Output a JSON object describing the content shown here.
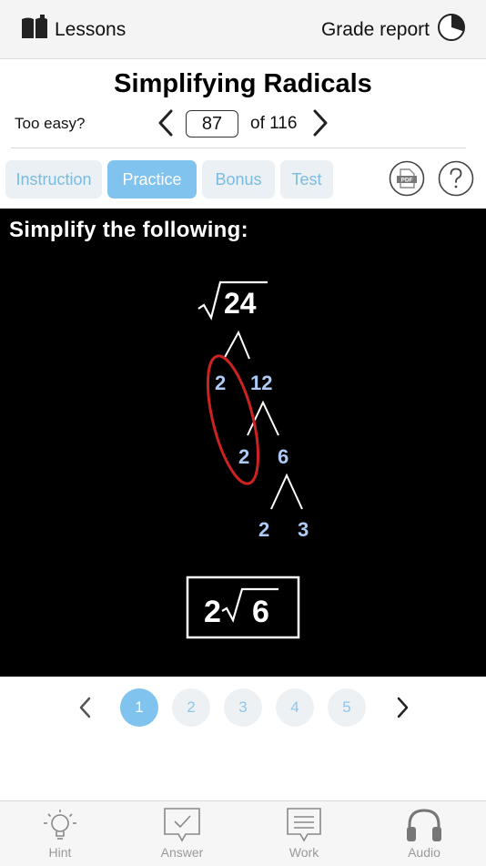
{
  "header": {
    "lessons_label": "Lessons",
    "grade_report_label": "Grade report"
  },
  "lesson": {
    "title": "Simplifying Radicals",
    "too_easy": "Too easy?",
    "current_page": "87",
    "of_total": "of 116"
  },
  "tabs": [
    {
      "label": "Instruction"
    },
    {
      "label": "Practice"
    },
    {
      "label": "Bonus"
    },
    {
      "label": "Test"
    }
  ],
  "problem": {
    "heading": "Simplify the following:",
    "radicand": "24",
    "tree": {
      "level1_left": "2",
      "level1_right": "12",
      "level2_left": "2",
      "level2_right": "6",
      "level3_left": "2",
      "level3_right": "3"
    },
    "answer_coefficient": "2",
    "answer_radicand": "6"
  },
  "pager": {
    "pages": [
      "1",
      "2",
      "3",
      "4",
      "5"
    ],
    "active_page": "1"
  },
  "bottom_bar": {
    "hint": "Hint",
    "answer": "Answer",
    "work": "Work",
    "audio": "Audio"
  },
  "colors": {
    "accent": "#7fc3ee",
    "tab_inactive_text": "#7bbbe0",
    "tree_numbers": "#aecbf5",
    "circle_highlight": "#cc2222"
  },
  "icons": {
    "lessons": "book-icon",
    "grade_report": "pie-chart-icon",
    "pdf": "pdf-icon",
    "help": "question-icon",
    "hint": "lightbulb-icon",
    "answer": "checkmark-bubble-icon",
    "work": "notepad-bubble-icon",
    "audio": "headphones-icon"
  }
}
